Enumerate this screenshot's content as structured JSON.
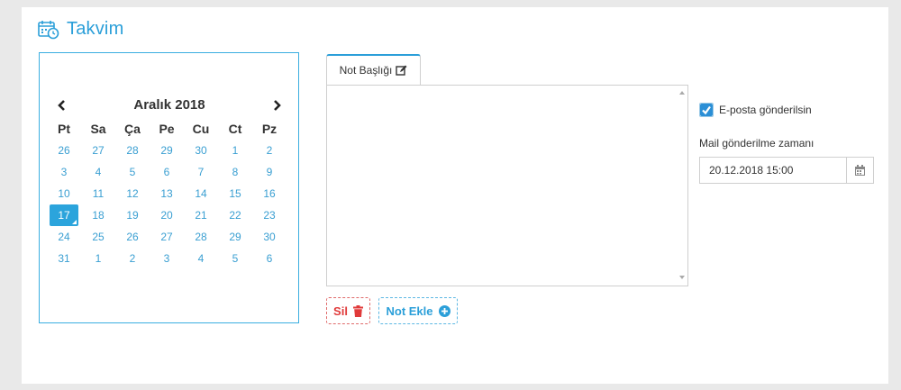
{
  "header": {
    "title": "Takvim",
    "icon": "calendar-clock-icon",
    "color": "#2b9fd9"
  },
  "calendar": {
    "month_title": "Aralık 2018",
    "prev_icon": "chevron-left-icon",
    "next_icon": "chevron-right-icon",
    "weekdays": [
      "Pt",
      "Sa",
      "Ça",
      "Pe",
      "Cu",
      "Ct",
      "Pz"
    ],
    "weeks": [
      [
        "26",
        "27",
        "28",
        "29",
        "30",
        "1",
        "2"
      ],
      [
        "3",
        "4",
        "5",
        "6",
        "7",
        "8",
        "9"
      ],
      [
        "10",
        "11",
        "12",
        "13",
        "14",
        "15",
        "16"
      ],
      [
        "17",
        "18",
        "19",
        "20",
        "21",
        "22",
        "23"
      ],
      [
        "24",
        "25",
        "26",
        "27",
        "28",
        "29",
        "30"
      ],
      [
        "31",
        "1",
        "2",
        "3",
        "4",
        "5",
        "6"
      ]
    ],
    "selected": "17"
  },
  "note": {
    "tab_label": "Not Başlığı",
    "tab_icon": "edit-icon",
    "content": ""
  },
  "actions": {
    "delete_label": "Sil",
    "delete_icon": "trash-icon",
    "add_label": "Not Ekle",
    "add_icon": "plus-circle-icon"
  },
  "email": {
    "checkbox_label": "E-posta gönderilsin",
    "checked": true,
    "time_label": "Mail gönderilme zamanı",
    "time_value": "20.12.2018 15:00",
    "time_icon": "calendar-icon"
  },
  "colors": {
    "accent": "#2b9fd9",
    "danger": "#e03a3a"
  }
}
